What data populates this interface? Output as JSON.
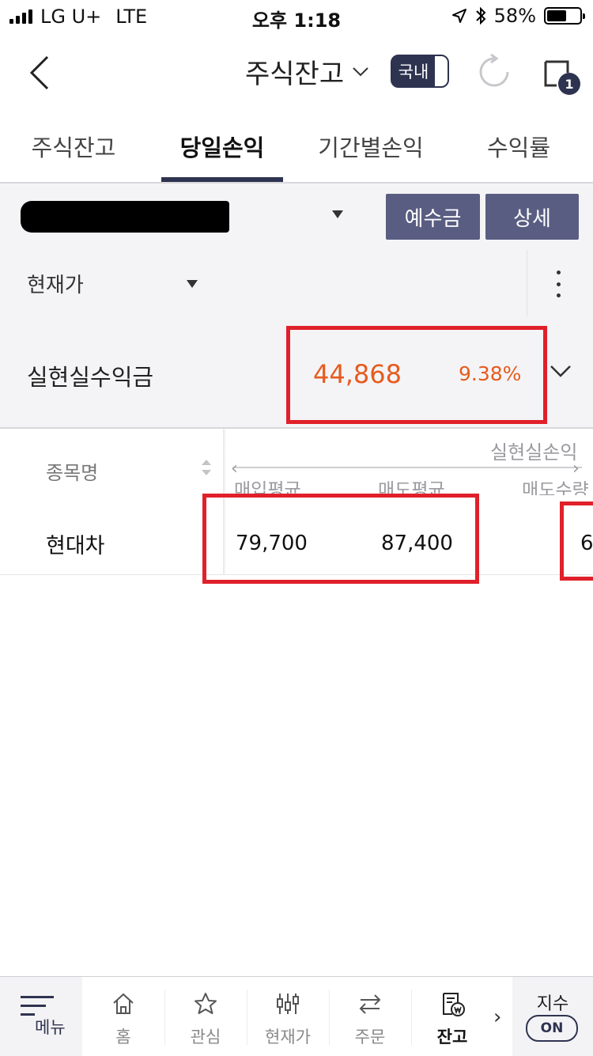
{
  "status_bar": {
    "carrier": "LG U+",
    "network": "LTE",
    "time": "오후 1:18",
    "battery": "58%"
  },
  "header": {
    "title": "주식잔고",
    "market_toggle": "국내",
    "notification_count": "1"
  },
  "tabs": [
    {
      "label": "주식잔고",
      "active": false
    },
    {
      "label": "당일손익",
      "active": true
    },
    {
      "label": "기간별손익",
      "active": false
    },
    {
      "label": "수익률",
      "active": false
    }
  ],
  "account": {
    "deposit_button": "예수금",
    "detail_button": "상세"
  },
  "price_selector": {
    "selected": "현재가"
  },
  "summary": {
    "label": "실현실수익금",
    "amount": "44,868",
    "rate": "9.38%"
  },
  "table": {
    "fixed_header": "종목명",
    "group_header": "실현실손익",
    "columns": [
      "매입평균",
      "매도평균",
      "매도수량"
    ],
    "rows": [
      {
        "name": "현대차",
        "buy_avg": "79,700",
        "sell_avg": "87,400",
        "sell_qty": "6"
      }
    ]
  },
  "bottom_nav": {
    "menu": "메뉴",
    "items": [
      {
        "label": "홈",
        "icon": "home-icon"
      },
      {
        "label": "관심",
        "icon": "star-icon"
      },
      {
        "label": "현재가",
        "icon": "candlestick-icon"
      },
      {
        "label": "주문",
        "icon": "exchange-icon"
      },
      {
        "label": "잔고",
        "icon": "balance-icon",
        "active": true
      }
    ],
    "index_label": "지수",
    "index_toggle": "ON"
  },
  "colors": {
    "accent": "#2e3350",
    "button": "#5a5d82",
    "profit": "#e65b1e",
    "highlight": "#e0202a"
  }
}
